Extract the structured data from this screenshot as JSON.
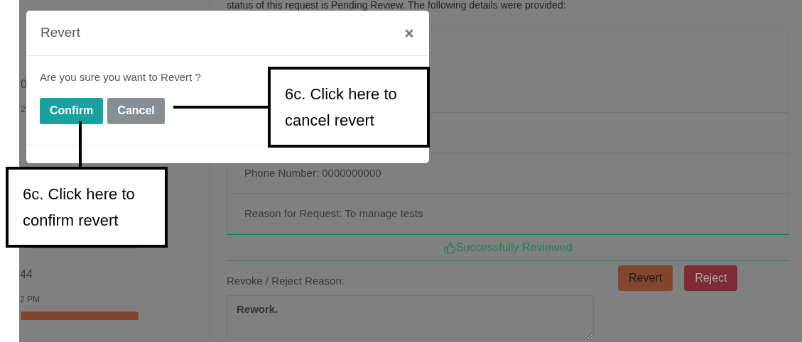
{
  "page": {
    "sidebar_texts": [
      "0",
      "2",
      "44",
      "2 PM"
    ],
    "intro_text": "status of this request is Pending Review. The following details were provided:",
    "details": [
      "Phone Number: 0000000000",
      "Reason for Request: To manage tests"
    ],
    "status": "Successfully Reviewed",
    "reason_label": "Revoke / Reject Reason:",
    "reason_value": "Rework.",
    "actions": [
      {
        "kind": "revert",
        "label": "Revert"
      },
      {
        "kind": "reject",
        "label": "Reject"
      }
    ]
  },
  "dialog": {
    "title": "Revert",
    "message": "Are you sure you want to Revert ?",
    "buttons": [
      {
        "kind": "confirm",
        "label": "Confirm"
      },
      {
        "kind": "cancel",
        "label": "Cancel"
      }
    ]
  },
  "annotations": [
    {
      "kind": "cancel",
      "lines": [
        "6c. Click here to",
        "cancel revert"
      ]
    },
    {
      "kind": "confirm",
      "lines": [
        "6c. Click here to",
        "confirm revert"
      ]
    }
  ]
}
